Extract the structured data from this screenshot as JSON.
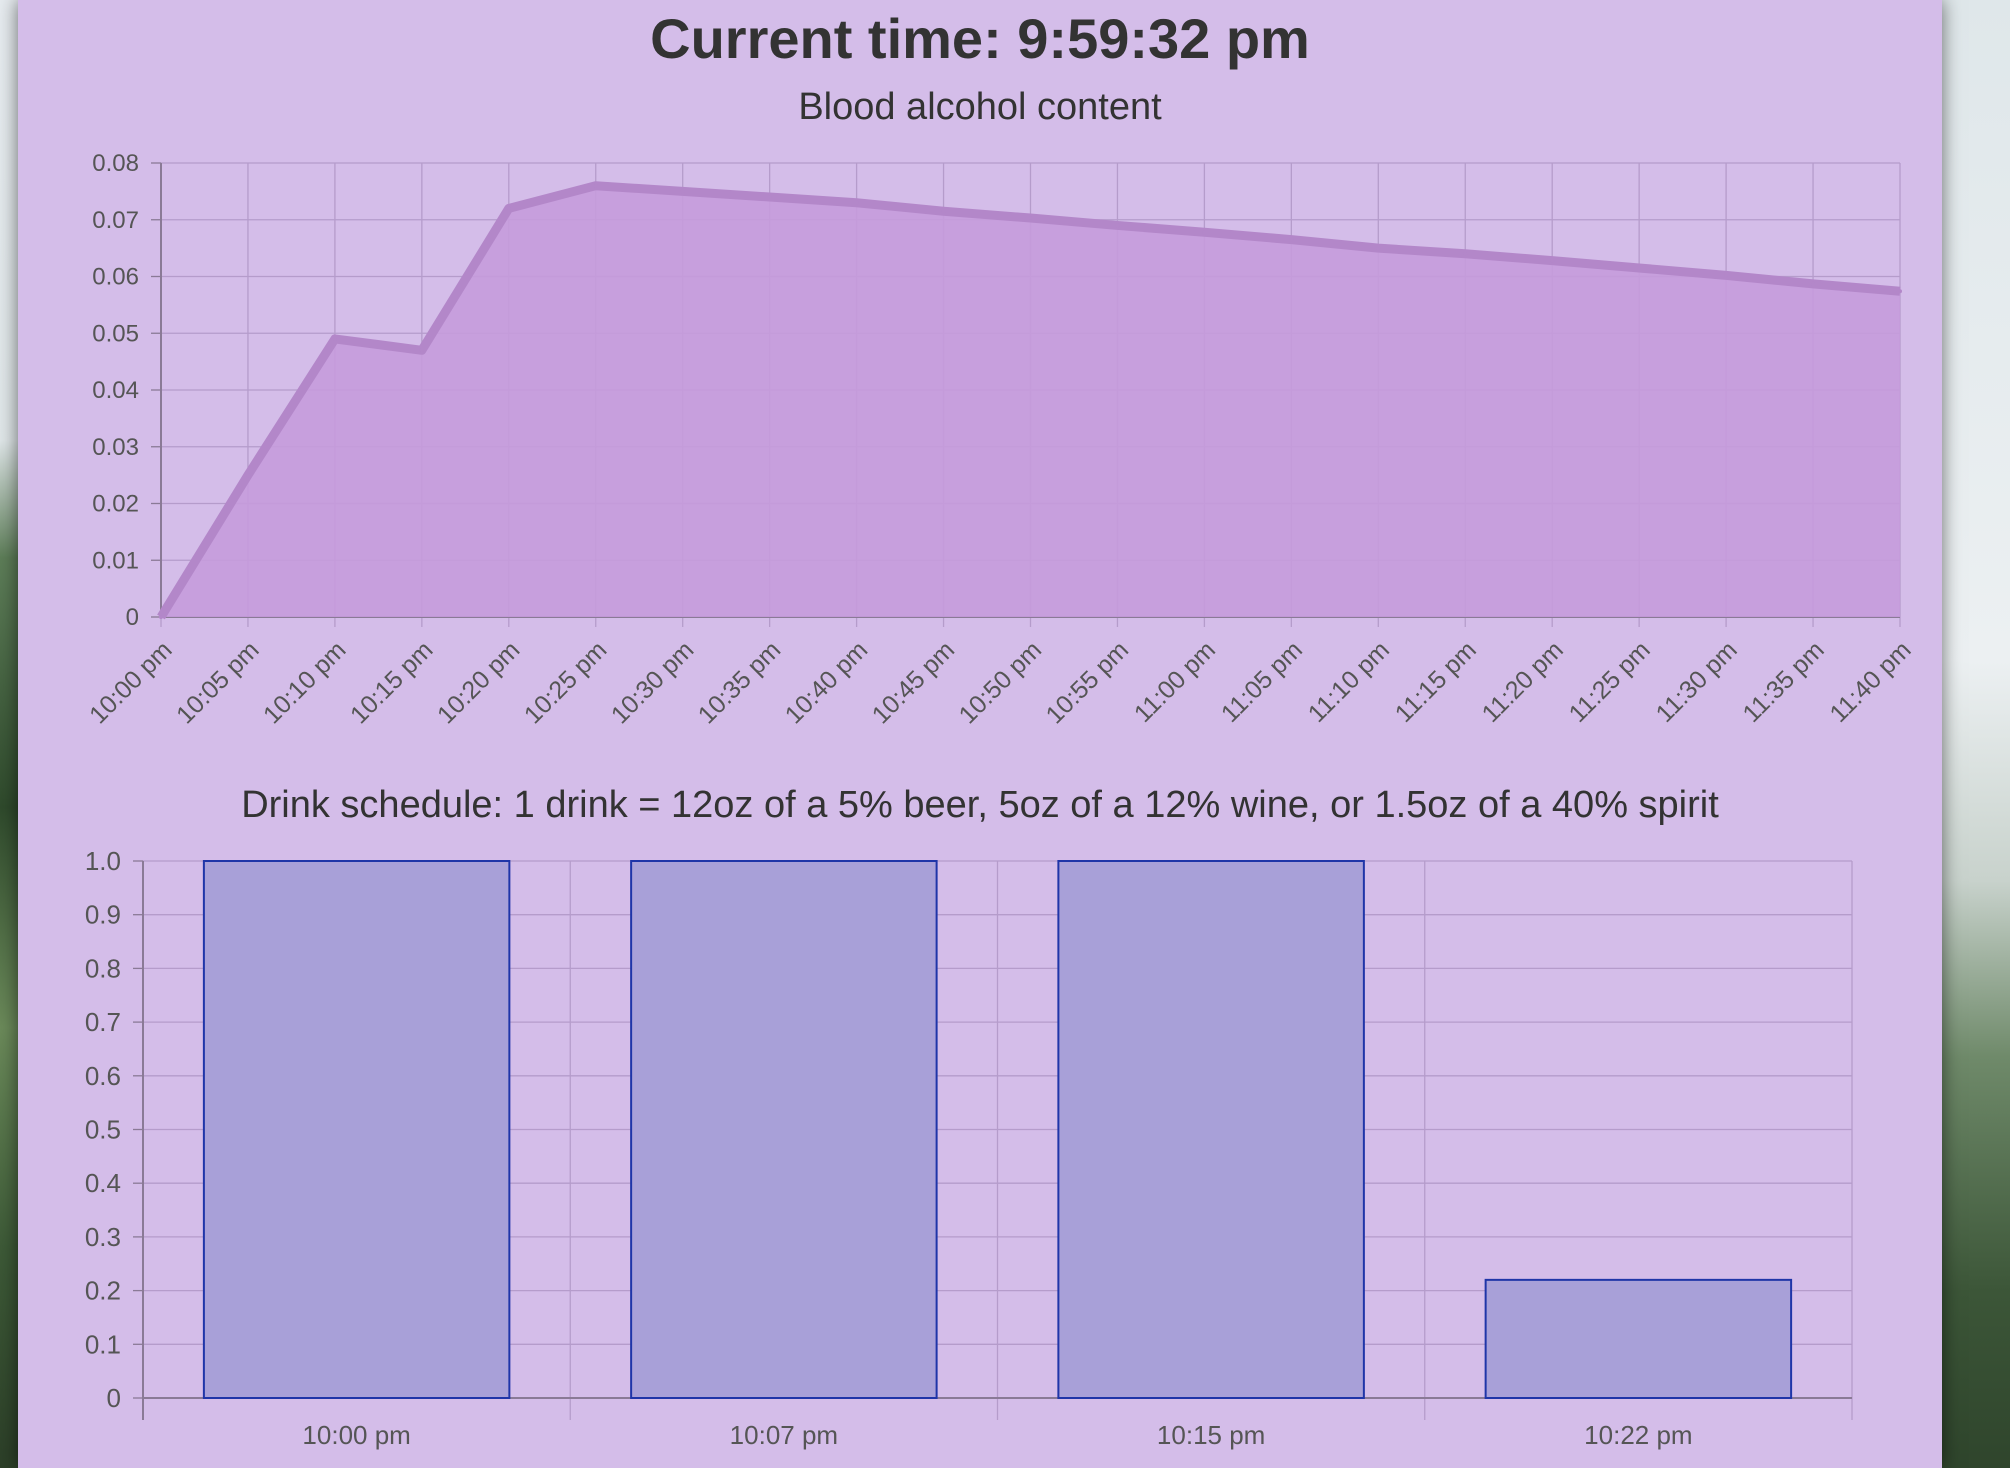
{
  "header": {
    "current_time_label": "Current time: 9:59:32 pm"
  },
  "colors": {
    "panel_background": "#d4bde9",
    "bac_fill": "#c59bdc",
    "bac_line": "#b387c9",
    "bar_fill": "#a8a0d8",
    "bar_border": "#1f35a8",
    "grid": "#b59ccb",
    "axis": "#8a7a96"
  },
  "chart_data": [
    {
      "type": "area",
      "title": "Blood alcohol content",
      "xlabel": "",
      "ylabel": "",
      "x": [
        "10:00 pm",
        "10:05 pm",
        "10:10 pm",
        "10:15 pm",
        "10:20 pm",
        "10:25 pm",
        "10:30 pm",
        "10:35 pm",
        "10:40 pm",
        "10:45 pm",
        "10:50 pm",
        "10:55 pm",
        "11:00 pm",
        "11:05 pm",
        "11:10 pm",
        "11:15 pm",
        "11:20 pm",
        "11:25 pm",
        "11:30 pm",
        "11:35 pm",
        "11:40 pm"
      ],
      "series": [
        {
          "values": [
            0,
            0.025,
            0.049,
            0.047,
            0.072,
            0.076,
            0.075,
            0.074,
            0.073,
            0.0715,
            0.0703,
            0.069,
            0.0678,
            0.0665,
            0.065,
            0.064,
            0.0628,
            0.0615,
            0.0602,
            0.0587,
            0.0574
          ]
        }
      ],
      "yticks": [
        "0",
        "0.01",
        "0.02",
        "0.03",
        "0.04",
        "0.05",
        "0.06",
        "0.07",
        "0.08"
      ],
      "ylim": [
        0,
        0.08
      ],
      "grid": true
    },
    {
      "type": "bar",
      "title": "Drink schedule: 1 drink = 12oz of a 5% beer, 5oz of a 12% wine, or 1.5oz of a 40% spirit",
      "xlabel": "",
      "ylabel": "",
      "categories": [
        "10:00 pm",
        "10:07 pm",
        "10:15 pm",
        "10:22 pm"
      ],
      "values": [
        1.0,
        1.0,
        1.0,
        0.22
      ],
      "yticks": [
        "0",
        "0.1",
        "0.2",
        "0.3",
        "0.4",
        "0.5",
        "0.6",
        "0.7",
        "0.8",
        "0.9",
        "1.0"
      ],
      "ylim": [
        0,
        1.0
      ],
      "grid": true
    }
  ]
}
